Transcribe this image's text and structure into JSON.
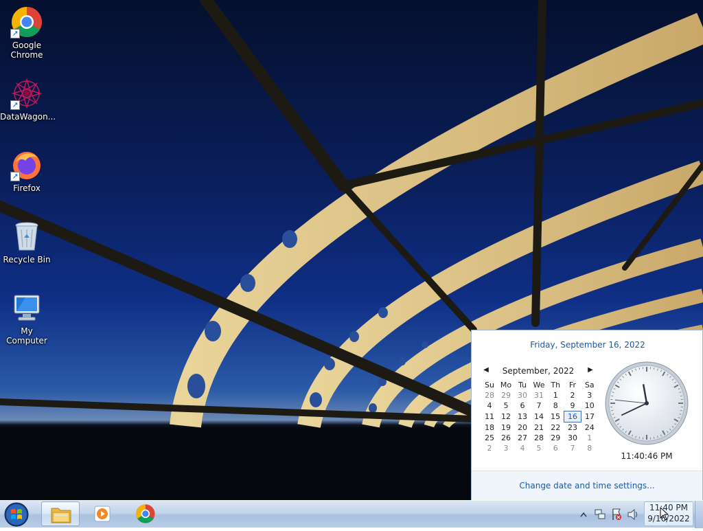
{
  "desktop": {
    "icons": [
      {
        "label": "Google Chrome",
        "icon": "chrome-icon"
      },
      {
        "label": "DataWagon...",
        "icon": "datawagon-icon"
      },
      {
        "label": "Firefox",
        "icon": "firefox-icon"
      },
      {
        "label": "Recycle Bin",
        "icon": "recycle-bin-icon"
      },
      {
        "label": "My Computer",
        "icon": "my-computer-icon"
      }
    ]
  },
  "taskbar": {
    "start_icon": "windows-start-icon",
    "pinned": [
      {
        "icon": "explorer-folder-icon",
        "active": true
      },
      {
        "icon": "media-player-icon",
        "active": false
      },
      {
        "icon": "chrome-icon",
        "active": false
      }
    ],
    "tray_icons": [
      "show-hidden-icons-chevron",
      "network-icon",
      "action-center-flag-icon",
      "volume-icon"
    ],
    "clock": {
      "time": "11:40 PM",
      "date": "9/16/2022"
    }
  },
  "calendar_popup": {
    "long_date": "Friday, September 16, 2022",
    "month_title": "September, 2022",
    "weekdays": [
      "Su",
      "Mo",
      "Tu",
      "We",
      "Th",
      "Fr",
      "Sa"
    ],
    "weeks": [
      [
        "28",
        "29",
        "30",
        "31",
        "1",
        "2",
        "3"
      ],
      [
        "4",
        "5",
        "6",
        "7",
        "8",
        "9",
        "10"
      ],
      [
        "11",
        "12",
        "13",
        "14",
        "15",
        "16",
        "17"
      ],
      [
        "18",
        "19",
        "20",
        "21",
        "22",
        "23",
        "24"
      ],
      [
        "25",
        "26",
        "27",
        "28",
        "29",
        "30",
        "1"
      ],
      [
        "2",
        "3",
        "4",
        "5",
        "6",
        "7",
        "8"
      ]
    ],
    "today": "16",
    "digital_time": "11:40:46 PM",
    "analog": {
      "hours": 11,
      "minutes": 40,
      "seconds": 46
    },
    "settings_link": "Change date and time settings...",
    "accent_color": "#1c5aa6"
  }
}
